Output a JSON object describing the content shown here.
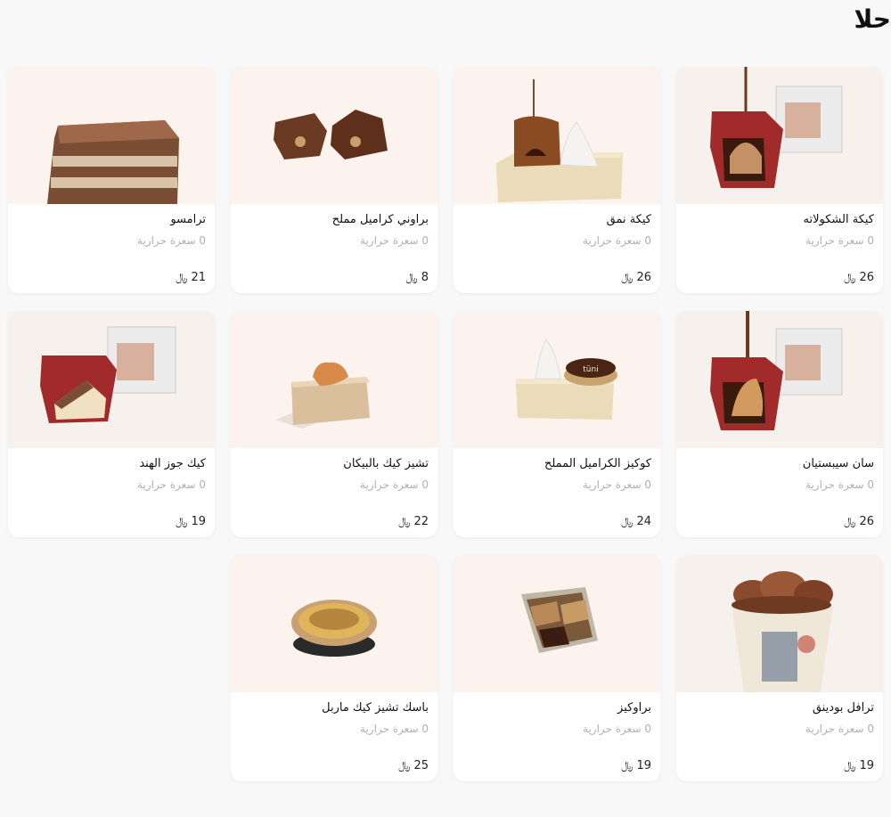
{
  "section": {
    "title": "حلا"
  },
  "calorie_suffix": "سعرة حرارية",
  "currency_symbol": "﷼",
  "products": [
    {
      "name": "كيكة الشكولاته",
      "calories": "0",
      "price": "26",
      "icon": "chocolate-cake-box-image"
    },
    {
      "name": "كيكة نمق",
      "calories": "0",
      "price": "26",
      "icon": "lava-cake-image"
    },
    {
      "name": "براوني كراميل مملح",
      "calories": "0",
      "price": "8",
      "icon": "brownie-image"
    },
    {
      "name": "ترامسو",
      "calories": "0",
      "price": "21",
      "icon": "tiramisu-image"
    },
    {
      "name": "سان سيبستيان",
      "calories": "0",
      "price": "26",
      "icon": "san-sebastian-box-image"
    },
    {
      "name": "كوكيز الكراميل المملح",
      "calories": "0",
      "price": "24",
      "icon": "cookie-image"
    },
    {
      "name": "تشيز كيك بالبيكان",
      "calories": "0",
      "price": "22",
      "icon": "pecan-cheesecake-image"
    },
    {
      "name": "كيك جوز الهند",
      "calories": "0",
      "price": "19",
      "icon": "coconut-cake-box-image"
    },
    {
      "name": "ترافل بودينق",
      "calories": "0",
      "price": "19",
      "icon": "truffle-pudding-cup-image"
    },
    {
      "name": "براوكيز",
      "calories": "0",
      "price": "19",
      "icon": "brookies-tray-image"
    },
    {
      "name": "باسك تشيز كيك ماربل",
      "calories": "0",
      "price": "25",
      "icon": "basque-cheesecake-image"
    }
  ]
}
